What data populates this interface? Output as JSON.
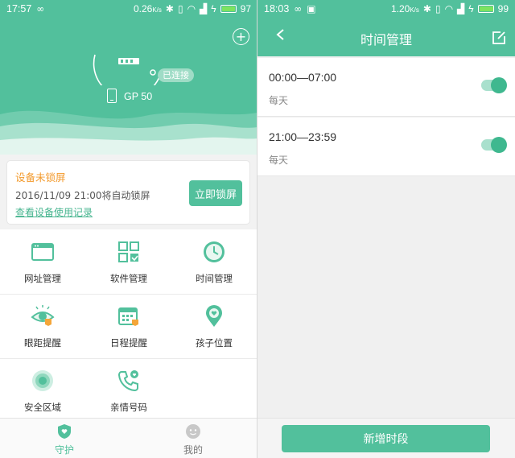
{
  "left": {
    "status": {
      "time": "17:57",
      "network_speed": "0.26",
      "network_unit": "K/s",
      "battery": "97"
    },
    "device": {
      "status_badge": "已连接",
      "name": "GP 50"
    },
    "alert": {
      "title": "设备未锁屏",
      "description": "2016/11/09 21:00将自动锁屏",
      "link": "查看设备使用记录",
      "action": "立即锁屏"
    },
    "features": [
      {
        "label": "网址管理",
        "icon": "browser-icon"
      },
      {
        "label": "软件管理",
        "icon": "apps-icon"
      },
      {
        "label": "时间管理",
        "icon": "clock-icon"
      },
      {
        "label": "眼距提醒",
        "icon": "eye-icon"
      },
      {
        "label": "日程提醒",
        "icon": "calendar-icon"
      },
      {
        "label": "孩子位置",
        "icon": "location-icon"
      },
      {
        "label": "安全区域",
        "icon": "safe-zone-icon"
      },
      {
        "label": "亲情号码",
        "icon": "phone-call-icon"
      }
    ],
    "tabs": [
      {
        "label": "守护",
        "icon": "shield-icon",
        "active": true
      },
      {
        "label": "我的",
        "icon": "face-icon",
        "active": false
      }
    ]
  },
  "right": {
    "status": {
      "time": "18:03",
      "network_speed": "1.20",
      "network_unit": "K/s",
      "battery": "99"
    },
    "title": "时间管理",
    "periods": [
      {
        "range": "00:00—07:00",
        "repeat": "每天",
        "enabled": true
      },
      {
        "range": "21:00—23:59",
        "repeat": "每天",
        "enabled": true
      }
    ],
    "add_button": "新增时段"
  },
  "colors": {
    "brand": "#52c09c",
    "warning": "#f39a2c",
    "toggle_on": "#3fb88f"
  }
}
